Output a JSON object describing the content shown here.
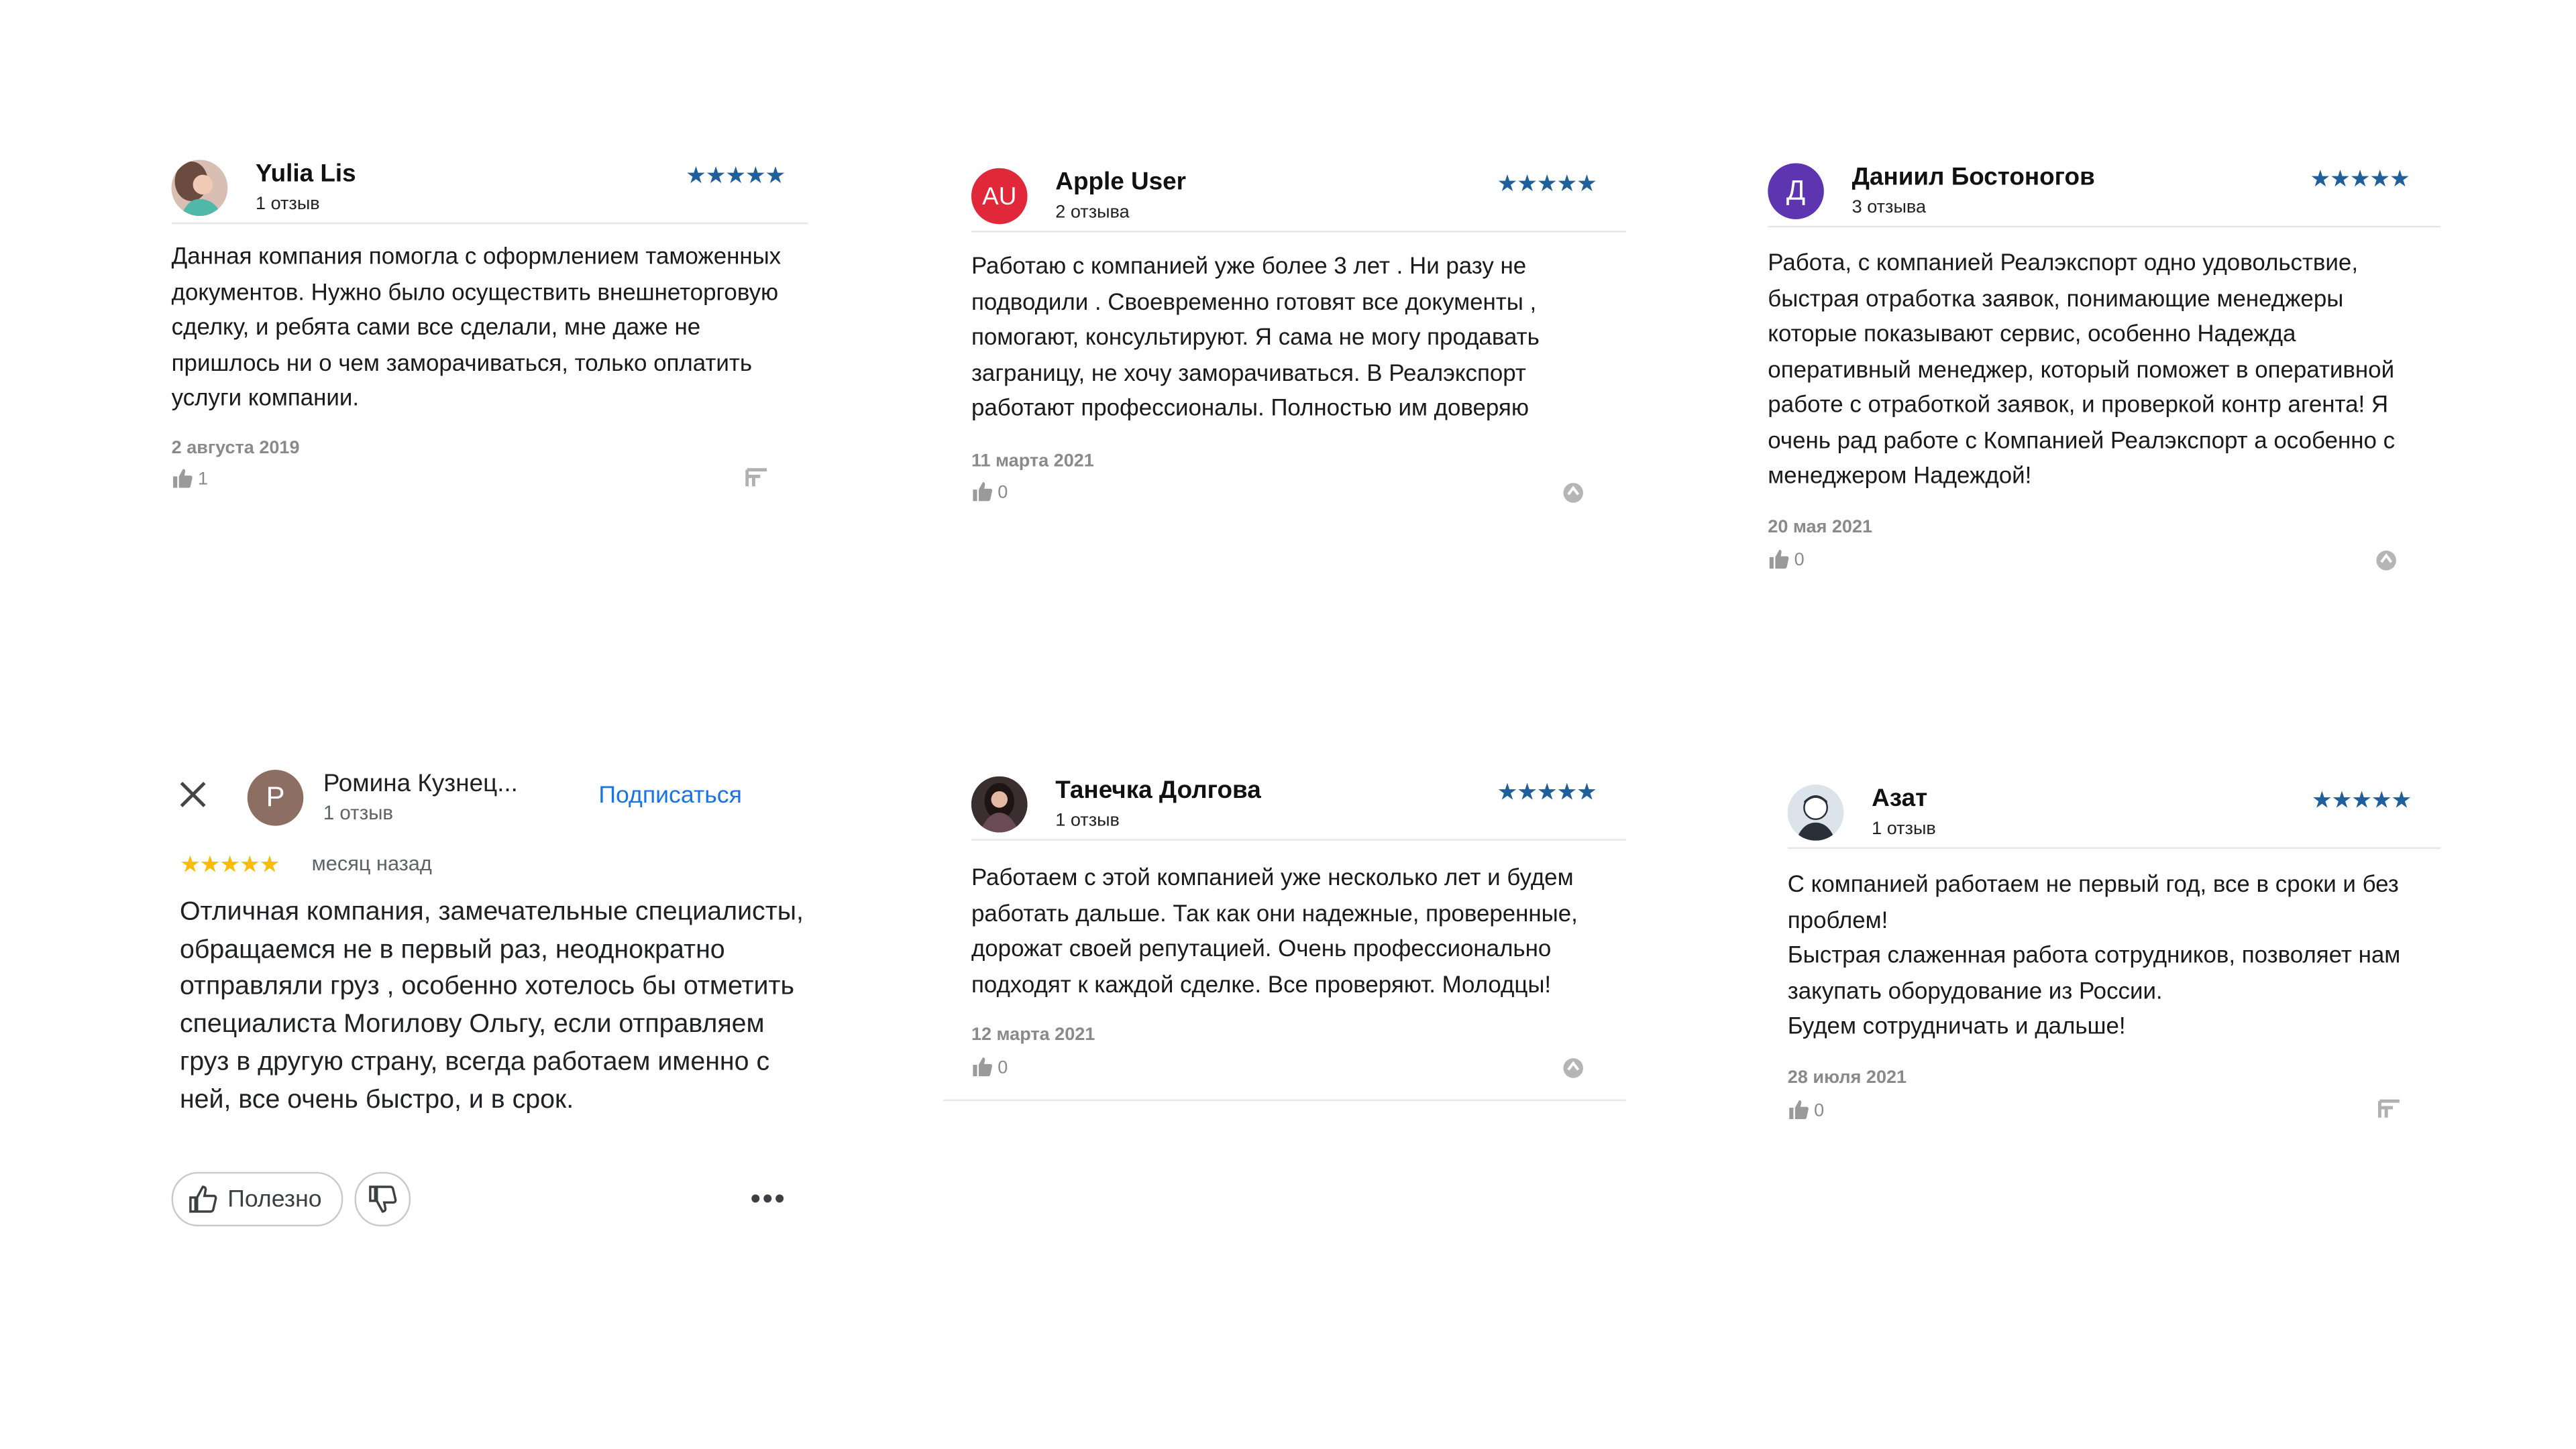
{
  "reviews": [
    {
      "name": "Yulia Lis",
      "count": "1 отзыв",
      "rating": 5,
      "text": "Данная компания помогла с оформлением таможенных документов. Нужно было осуществить внешнеторговую сделку, и ребята сами все сделали, мне даже не пришлось ни о чем заморачиваться, только оплатить услуги компании.",
      "date": "2 августа 2019",
      "likes": "1",
      "avatar": "photo"
    },
    {
      "name": "Apple User",
      "count": "2 отзыва",
      "rating": 5,
      "text": "Работаю с компанией уже более 3 лет . Ни разу не подводили . Своевременно готовят все документы , помогают, консультируют. Я сама не могу продавать заграницу, не хочу заморачиваться. В Реалэкспорт работают профессионалы. Полностью им доверяю",
      "date": "11 марта 2021",
      "likes": "0",
      "avatar_initials": "AU",
      "avatar_color": "#e0283a"
    },
    {
      "name": "Даниил Бостоногов",
      "count": "3 отзыва",
      "rating": 5,
      "text": "Работа, с компанией Реалэкспорт одно удовольствие, быстрая отработка заявок, понимающие менеджеры которые показывают сервис, особенно Надежда оперативный менеджер, который поможет в оперативной работе с отработкой заявок, и проверкой контр агента! Я очень рад работе с Компанией Реалэкспорт а особенно с менеджером Надеждой!",
      "date": "20 мая 2021",
      "likes": "0",
      "avatar_initials": "Д",
      "avatar_color": "#5e35b1"
    },
    {
      "name": "Танечка Долгова",
      "count": "1 отзыв",
      "rating": 5,
      "text": "Работаем с этой компанией уже несколько лет и будем работать дальше. Так как они надежные, проверенные, дорожат своей репутацией. Очень профессионально подходят к каждой сделке. Все проверяют. Молодцы!",
      "date": "12 марта 2021",
      "likes": "0",
      "avatar": "photo"
    },
    {
      "name": "Азат",
      "count": "1 отзыв",
      "rating": 5,
      "text": "С компанией работаем не первый год, все в сроки и без проблем!\nБыстрая слаженная работа сотрудников, позволяет нам закупать оборудование из России.\nБудем сотрудничать и дальше!",
      "date": "28 июля 2021",
      "likes": "0",
      "avatar": "default-user"
    }
  ],
  "google_review": {
    "name": "Ромина Кузнец...",
    "initial": "Р",
    "count": "1 отзыв",
    "subscribe_label": "Подписаться",
    "rating": 5,
    "time": "месяц назад",
    "text": "Отличная компания, замечательные специалисты, обращаемся не в первый раз, неоднократно отправляли груз , особенно хотелось бы отметить специалиста Могилову Ольгу, если отправляем груз в другую страну, всегда работаем именно с ней, все очень быстро, и в срок.",
    "useful_label": "Полезно",
    "more_label": "•••"
  },
  "stars_text": "★★★★★",
  "colors": {
    "star_blue": "#1f5f9c",
    "star_gold": "#fbbc04",
    "link_blue": "#1a73e8"
  }
}
